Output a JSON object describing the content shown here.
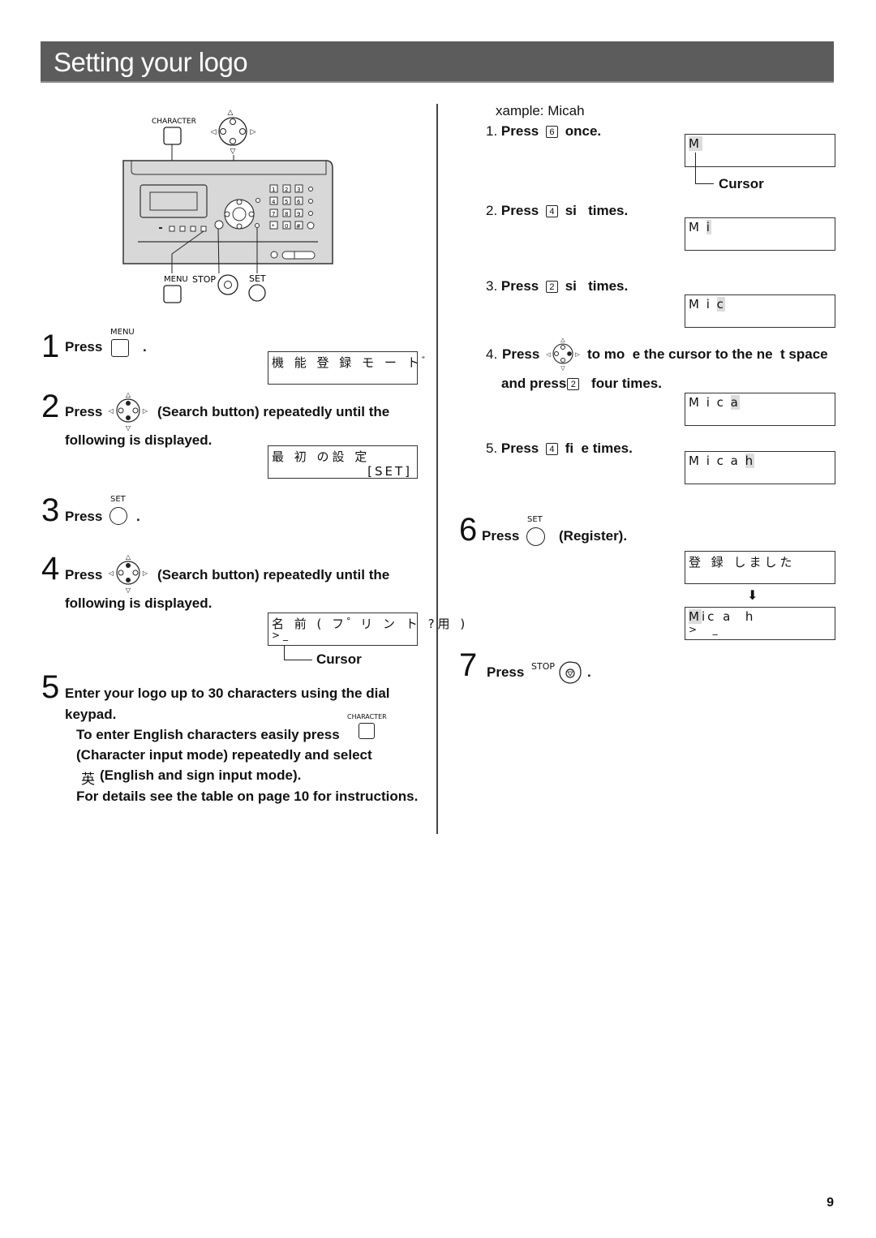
{
  "page": {
    "title": "Setting your logo",
    "page_number": "9"
  },
  "device_diagram": {
    "labels": {
      "character": "CHARACTER",
      "menu": "MENU",
      "stop": "STOP",
      "set": "SET"
    },
    "keypad": [
      "1",
      "2",
      "3",
      "4",
      "5",
      "6",
      "7",
      "8",
      "9",
      "*",
      "0",
      "#"
    ]
  },
  "left_steps": {
    "step1": {
      "num": "1",
      "press": "Press",
      "btn_label": "MENU",
      "suffix": ".",
      "lcd_line1": "機 能 登 録 モ ー ト ゙"
    },
    "step2": {
      "num": "2",
      "press": "Press",
      "text": "(Search button) repeatedly until the",
      "text2": "following is displayed.",
      "lcd_line1": "最 初 の設 定",
      "lcd_line2": "[SET]"
    },
    "step3": {
      "num": "3",
      "press": "Press",
      "btn_label": "SET",
      "suffix": "."
    },
    "step4": {
      "num": "4",
      "press": "Press",
      "text": "(Search button) repeatedly until the",
      "text2": "following is displayed.",
      "lcd_line1": "名 前 ( フ ゚ リ ン ト ?用 )",
      "lcd_line2": ">_",
      "cursor_label": "Cursor"
    },
    "step5": {
      "num": "5",
      "line1": "Enter your logo  up to 30 characters  using the dial",
      "line2": "keypad.",
      "char_label": "CHARACTER",
      "line3": "To enter English characters easily  press",
      "line4": "(Character input mode) repeatedly and select",
      "line5_glyph": "英",
      "line5": "(English and sign input mode).",
      "line6": "For details  see the table on page 10 for instructions."
    }
  },
  "right_steps": {
    "example": "xample: Micah",
    "sub1": {
      "num": "1.",
      "press": "Press",
      "key": "6",
      "text": "once.",
      "lcd_plain": "",
      "lcd_hl": "M",
      "cursor_label": "Cursor"
    },
    "sub2": {
      "num": "2.",
      "press": "Press",
      "key": "4",
      "text": "si   times.",
      "lcd_plain": "M ",
      "lcd_hl": "i"
    },
    "sub3": {
      "num": "3.",
      "press": "Press",
      "key": "2",
      "text": "si   times.",
      "lcd_plain": "M i ",
      "lcd_hl": "c"
    },
    "sub4": {
      "num": "4.",
      "press": "Press",
      "text": "to mo  e the cursor to the ne  t space",
      "text2a": "and press",
      "key": "2",
      "text2b": "four times.",
      "lcd_plain": "M i c ",
      "lcd_hl": "a"
    },
    "sub5": {
      "num": "5.",
      "press": "Press",
      "key": "4",
      "text": "fi  e times.",
      "lcd_plain": "M i c a ",
      "lcd_hl": "h"
    },
    "step6": {
      "num": "6",
      "press": "Press",
      "btn_label": "SET",
      "text": "(Register).",
      "lcd1_line1": "登 録 しました",
      "lcd2_hl": "M",
      "lcd2_line1": "ic a  h",
      "lcd2_line2": ">  _"
    },
    "step7": {
      "num": "7",
      "press": "Press",
      "btn_label": "STOP",
      "suffix": "."
    }
  }
}
